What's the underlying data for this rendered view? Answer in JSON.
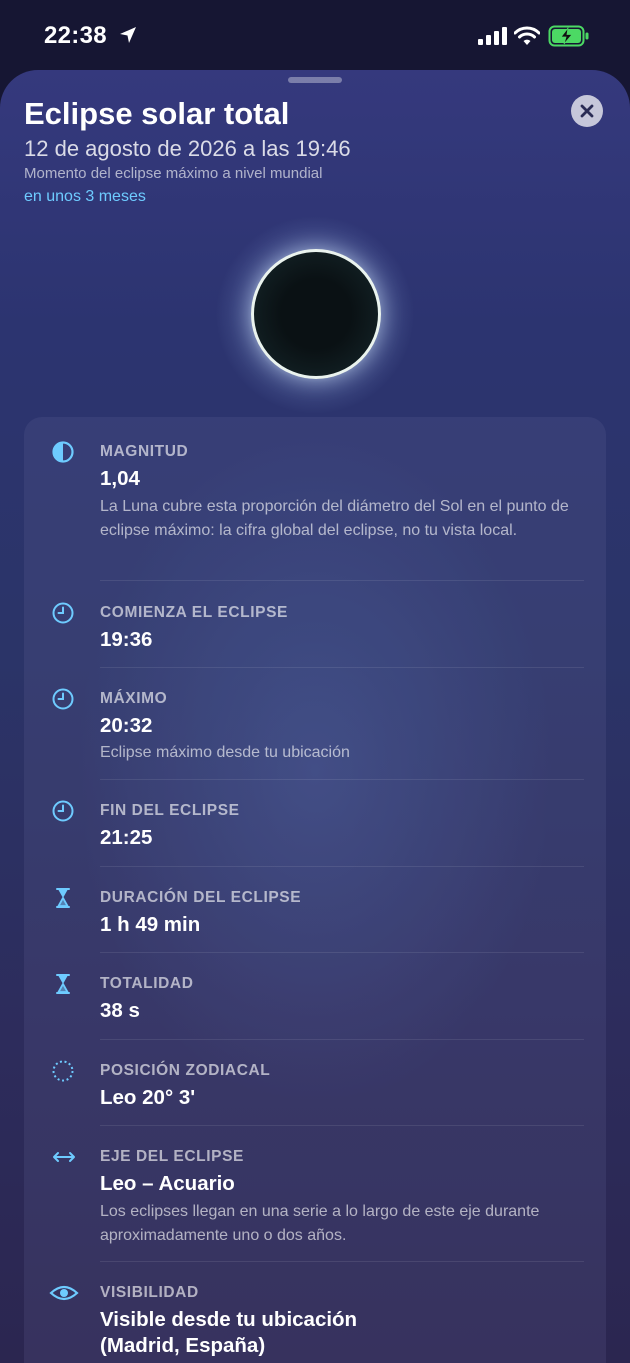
{
  "status_bar": {
    "time": "22:38",
    "icons": [
      "location-arrow-icon",
      "cellular-signal-icon",
      "wifi-icon",
      "battery-charging-icon"
    ]
  },
  "sheet": {
    "title": "Eclipse solar total",
    "date": "12 de agosto de 2026 a las 19:46",
    "caption": "Momento del eclipse máximo a nivel mundial",
    "relative": "en unos 3 meses",
    "close_icon": "close-icon"
  },
  "details": [
    {
      "icon": "half-circle-icon",
      "label": "MAGNITUD",
      "value": "1,04",
      "desc": "La Luna cubre esta proporción del diámetro del Sol en el punto de eclipse máximo: la cifra global del eclipse, no tu vista local."
    },
    {
      "icon": "clock-icon",
      "label": "COMIENZA EL ECLIPSE",
      "value": "19:36",
      "desc": ""
    },
    {
      "icon": "clock-icon",
      "label": "MÁXIMO",
      "value": "20:32",
      "desc": "Eclipse máximo desde tu ubicación"
    },
    {
      "icon": "clock-icon",
      "label": "FIN DEL ECLIPSE",
      "value": "21:25",
      "desc": ""
    },
    {
      "icon": "hourglass-icon",
      "label": "DURACIÓN DEL ECLIPSE",
      "value": "1 h 49 min",
      "desc": ""
    },
    {
      "icon": "hourglass-icon",
      "label": "TOTALIDAD",
      "value": "38 s",
      "desc": ""
    },
    {
      "icon": "dotted-circle-icon",
      "label": "POSICIÓN ZODIACAL",
      "value": "Leo 20° 3'",
      "desc": ""
    },
    {
      "icon": "double-arrow-icon",
      "label": "EJE DEL ECLIPSE",
      "value": "Leo – Acuario",
      "desc": "Los eclipses llegan en una serie a lo largo de este eje durante aproximadamente uno o dos años."
    },
    {
      "icon": "eye-icon",
      "label": "VISIBILIDAD",
      "value": "Visible desde tu ubicación (Madrid, España)",
      "desc": ""
    }
  ],
  "colors": {
    "accent": "#6ecbff",
    "background": "#2b3468"
  }
}
